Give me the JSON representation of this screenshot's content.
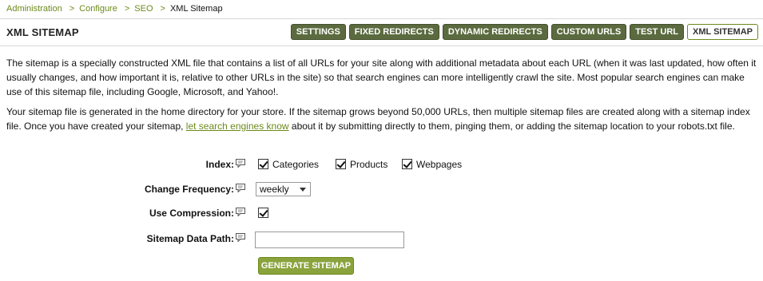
{
  "breadcrumb": {
    "items": [
      "Administration",
      "Configure",
      "SEO"
    ],
    "separator": ">",
    "current": "XML Sitemap"
  },
  "header": {
    "title": "XML SITEMAP",
    "tabs": [
      {
        "label": "SETTINGS",
        "active": false
      },
      {
        "label": "FIXED REDIRECTS",
        "active": false
      },
      {
        "label": "DYNAMIC REDIRECTS",
        "active": false
      },
      {
        "label": "CUSTOM URLS",
        "active": false
      },
      {
        "label": "TEST URL",
        "active": false
      },
      {
        "label": "XML SITEMAP",
        "active": true
      }
    ]
  },
  "description": {
    "paragraph1": "The sitemap is a specially constructed XML file that contains a list of all URLs for your site along with additional metadata about each URL (when it was last updated, how often it usually changes, and how important it is, relative to other URLs in the site) so that search engines can more intelligently crawl the site. Most popular search engines can make use of this sitemap file, including Google, Microsoft, and Yahoo!.",
    "paragraph2_before": "Your sitemap file is generated in the home directory for your store. If the sitemap grows beyond 50,000 URLs, then multiple sitemap files are created along with a sitemap index file. Once you have created your sitemap,",
    "paragraph2_link": "let search engines know",
    "paragraph2_after": "about it by submitting directly to them, pinging them, or adding the sitemap location to your robots.txt file."
  },
  "form": {
    "index": {
      "label": "Index:",
      "options": [
        {
          "label": "Categories",
          "checked": true
        },
        {
          "label": "Products",
          "checked": true
        },
        {
          "label": "Webpages",
          "checked": true
        }
      ]
    },
    "change_frequency": {
      "label": "Change Frequency:",
      "value": "weekly"
    },
    "use_compression": {
      "label": "Use Compression:",
      "checked": true
    },
    "sitemap_data_path": {
      "label": "Sitemap Data Path:",
      "value": ""
    },
    "submit_label": "GENERATE SITEMAP"
  },
  "colors": {
    "link": "#6b8a1a",
    "tab_bg": "#5b6b3f",
    "button_bg": "#8aa33c"
  },
  "icons": {
    "help": "help-bubble-icon",
    "dropdown": "chevron-down-icon",
    "check": "checkmark-icon"
  }
}
